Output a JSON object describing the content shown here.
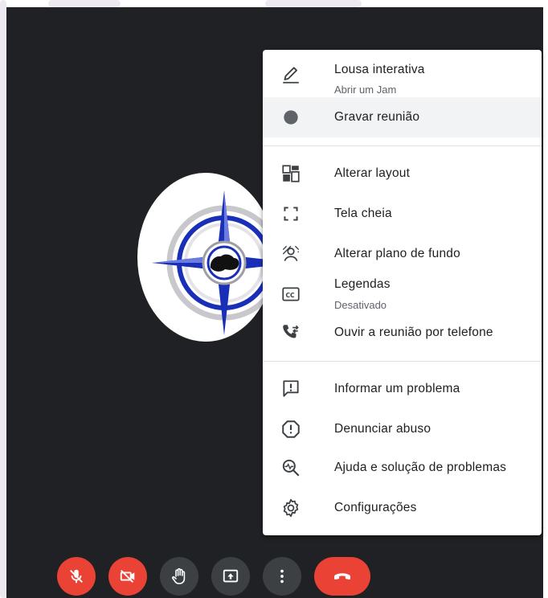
{
  "menu": {
    "items": [
      {
        "label": "Lousa interativa",
        "sublabel": "Abrir um Jam",
        "icon": "pencil-icon"
      },
      {
        "label": "Gravar reunião",
        "icon": "record-dot-icon"
      },
      {
        "label": "Alterar layout",
        "icon": "layout-icon"
      },
      {
        "label": "Tela cheia",
        "icon": "fullscreen-icon"
      },
      {
        "label": "Alterar plano de fundo",
        "icon": "background-icon"
      },
      {
        "label": "Legendas",
        "sublabel": "Desativado",
        "icon": "closed-captions-icon"
      },
      {
        "label": "Ouvir a reunião por telefone",
        "icon": "phone-transfer-icon"
      },
      {
        "label": "Informar um problema",
        "icon": "feedback-icon"
      },
      {
        "label": "Denunciar abuso",
        "icon": "report-icon"
      },
      {
        "label": "Ajuda e solução de problemas",
        "icon": "help-search-icon"
      },
      {
        "label": "Configurações",
        "icon": "settings-gear-icon"
      }
    ]
  },
  "controls": [
    {
      "name": "mic-off-button",
      "icon": "mic-off-icon",
      "color": "#ea4335"
    },
    {
      "name": "camera-off-button",
      "icon": "camera-off-icon",
      "color": "#ea4335"
    },
    {
      "name": "raise-hand-button",
      "icon": "hand-icon",
      "color": "#3c4043"
    },
    {
      "name": "present-button",
      "icon": "present-screen-icon",
      "color": "#3c4043"
    },
    {
      "name": "more-options-button",
      "icon": "more-vert-icon",
      "color": "#3c4043"
    },
    {
      "name": "leave-call-button",
      "icon": "hang-up-icon",
      "color": "#ea4335"
    }
  ],
  "colors": {
    "stage": "#202124",
    "menu_highlight": "#f1f3f4",
    "red": "#ea4335",
    "dark_button": "#3c4043",
    "emblem_blue": "#1a2fb8"
  }
}
